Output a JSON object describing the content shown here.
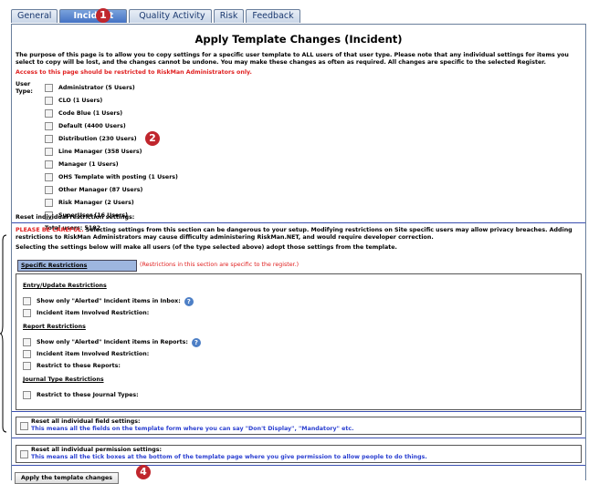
{
  "tabs": [
    {
      "label": "General"
    },
    {
      "label": "Incident"
    },
    {
      "label": "Quality Activity"
    },
    {
      "label": "Risk"
    },
    {
      "label": "Feedback"
    }
  ],
  "badges": {
    "b1": "1",
    "b2": "2",
    "b4": "4"
  },
  "page": {
    "title": "Apply Template Changes (Incident)",
    "intro": "The purpose of this page is to allow you to copy settings for a specific user template to ALL users of that user type. Please note that any individual settings for items you select to copy will be lost, and the changes cannot be undone. You may make these changes as often as required. All changes are specific to the selected Register.",
    "restriction_note": "Access to this page should be restricted to RiskMan Administrators only."
  },
  "user_type": {
    "label": "User Type:",
    "options": [
      "Administrator (5 Users)",
      "CLO (1 Users)",
      "Code Blue (1 Users)",
      "Default (4400 Users)",
      "Distribution (230 Users)",
      "Line Manager (358 Users)",
      "Manager (1 Users)",
      "OHS Template with posting (1 Users)",
      "Other Manager (87 Users)",
      "Risk Manager (2 Users)",
      "SuperUser (16 Users)"
    ],
    "total": "Total users: 5102"
  },
  "reset_restrictions": {
    "heading": "Reset individual restriction settings:",
    "warning_prefix": "PLEASE BE CAREFUL.",
    "warning": " Selecting settings from this section can be dangerous to your setup. Modifying restrictions on Site specific users may allow privacy breaches. Adding restrictions to RiskMan Administrators may cause difficulty administering RiskMan.NET, and would require developer correction.",
    "adopt_note": "Selecting the settings below will make all users (of the type selected above) adopt those settings from the template."
  },
  "specific": {
    "button": "Specific Restrictions",
    "note": "(Restrictions in this section are specific to the register.)",
    "entry_heading": "Entry/Update Restrictions",
    "entry_items": [
      "Show only \"Alerted\" Incident items in Inbox:",
      "Incident item Involved Restriction:"
    ],
    "report_heading": "Report Restrictions",
    "report_items": [
      "Show only \"Alerted\" Incident items in Reports:",
      "Incident item Involved Restriction:",
      "Restrict to these Reports:"
    ],
    "journal_heading": "Journal Type Restrictions",
    "journal_items": [
      "Restrict to these Journal Types:"
    ]
  },
  "field_settings": {
    "label": "Reset all individual field settings:",
    "desc": "This means all the fields on the template form where you can say \"Don't Display\", \"Mandatory\" etc."
  },
  "perm_settings": {
    "label": "Reset all individual permission settings:",
    "desc": "This means all the tick boxes at the bottom of the template page where you give permission to allow people to do things."
  },
  "apply_button": "Apply the template changes",
  "help_icon": "?"
}
